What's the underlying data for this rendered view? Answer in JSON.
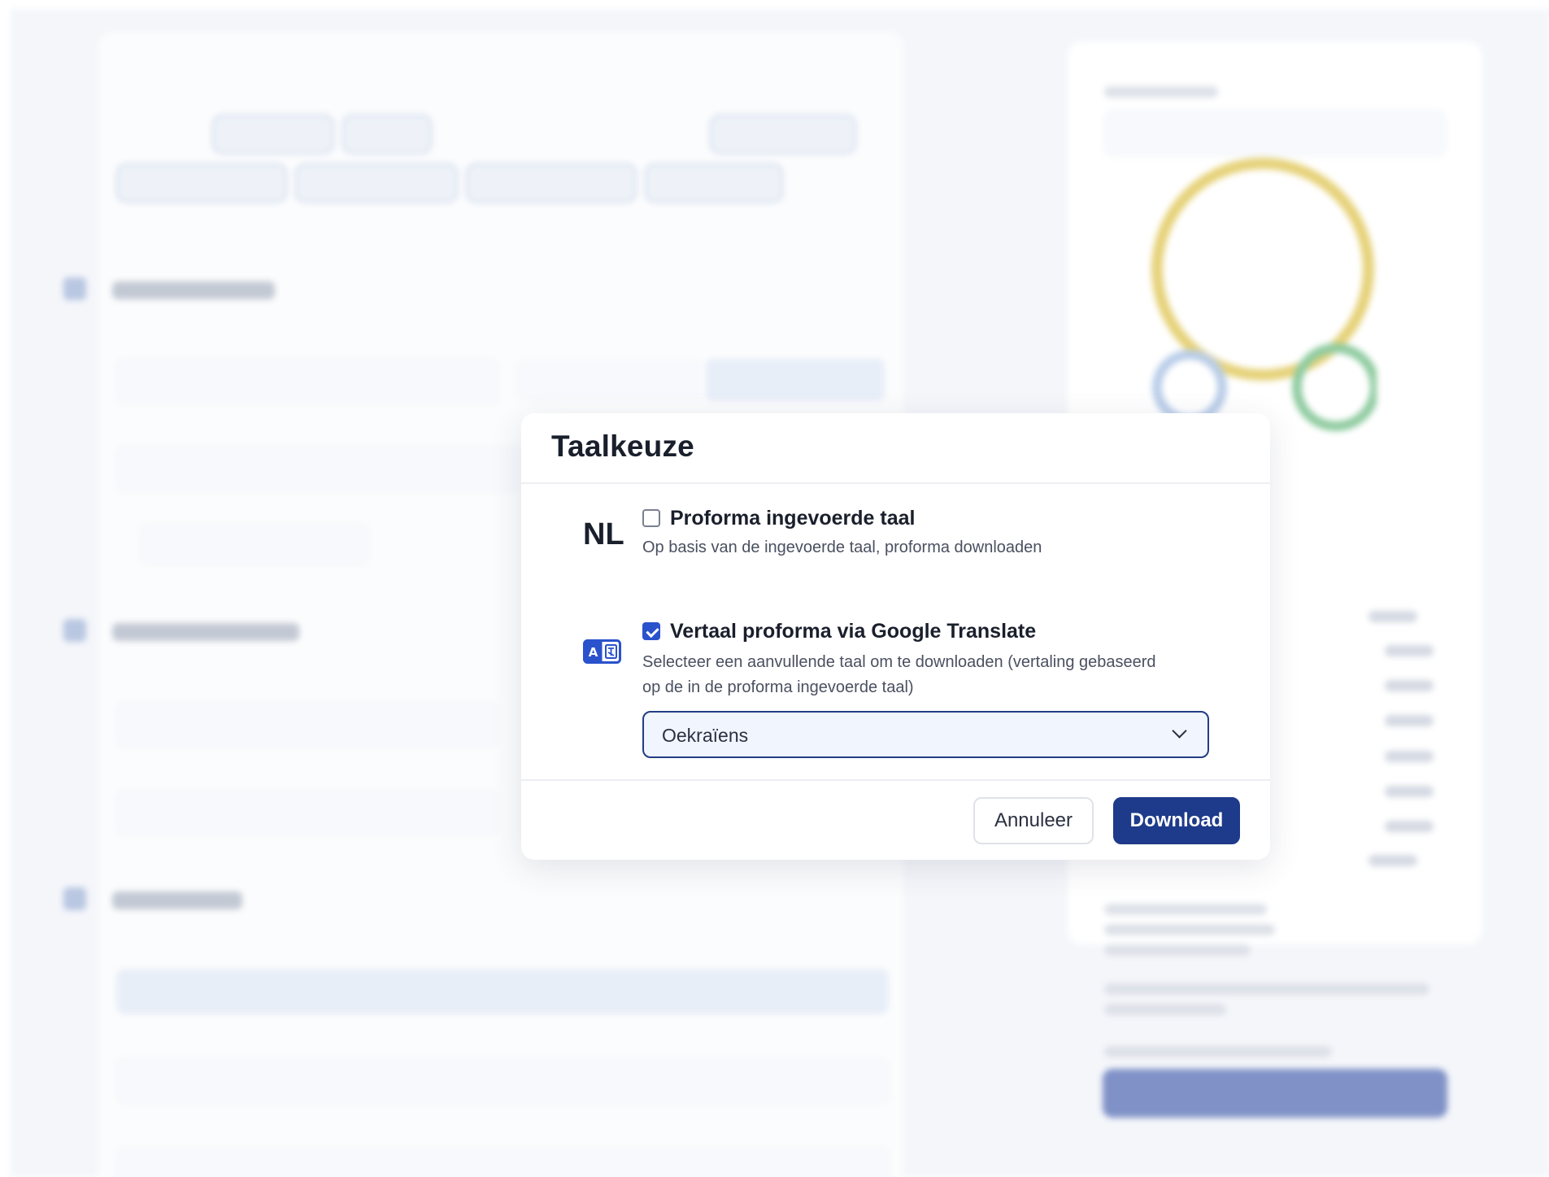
{
  "modal": {
    "title": "Taalkeuze",
    "option_original": {
      "badge": "NL",
      "label": "Proforma ingevoerde taal",
      "description": "Op basis van de ingevoerde taal, proforma downloaden",
      "checked": false
    },
    "option_translate": {
      "icon": "translate-icon",
      "label": "Vertaal proforma via Google Translate",
      "description": "Selecteer een aanvullende taal om te downloaden (vertaling gebaseerd op de in de proforma ingevoerde taal)",
      "checked": true,
      "selected_language": "Oekraïens"
    },
    "cancel_label": "Annuleer",
    "download_label": "Download"
  },
  "colors": {
    "primary": "#1e3a8a",
    "checkbox_checked": "#2952cc",
    "select_bg": "#f1f5fd"
  }
}
